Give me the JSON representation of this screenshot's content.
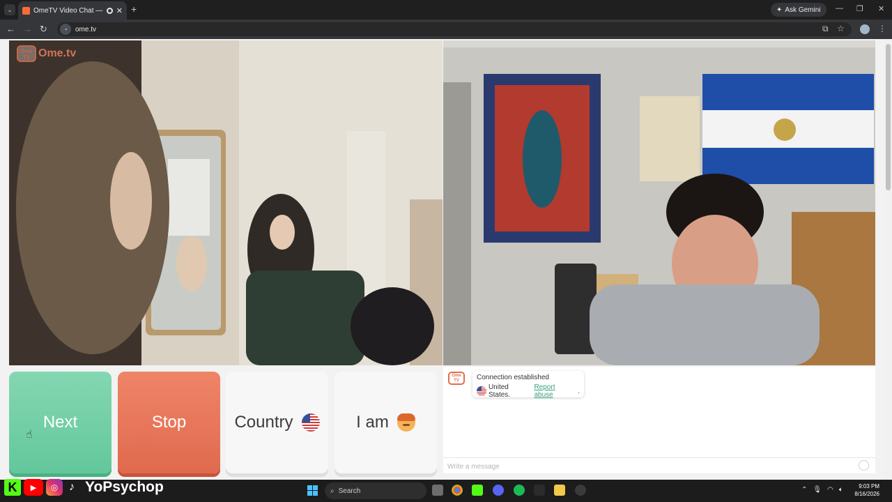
{
  "browser": {
    "tab_title": "OmeTV Video Chat — Ome",
    "tab_close": "✕",
    "new_tab": "+",
    "ask_gemini": "Ask Gemini",
    "url": "ome.tv",
    "window_controls": {
      "minimize": "—",
      "restore": "❐",
      "close": "✕"
    }
  },
  "logo": {
    "box_text": "Ome TV",
    "text": "Ome.tv"
  },
  "buttons": {
    "next": "Next",
    "stop": "Stop",
    "country": "Country",
    "i_am": "I am"
  },
  "chat": {
    "logo_text": "Ome TV",
    "message_line1": "Connection established",
    "message_country": "United States.",
    "report_link": "Report abuse",
    "message_end": ".",
    "input_placeholder": "Write a message"
  },
  "overlay": {
    "channel_name": "YoPsychop",
    "k_label": "K"
  },
  "taskbar": {
    "search_placeholder": "Search",
    "time": "9:03 PM",
    "date": "8/16/2026"
  },
  "icons": {
    "tab_list": "chevron-down-icon",
    "back": "arrow-left-icon",
    "forward": "arrow-right-icon",
    "reload": "reload-icon",
    "install": "install-app-icon",
    "bookmark": "star-icon",
    "menu": "kebab-menu-icon",
    "flag": "us-flag-icon",
    "emoji": "boy-emoji-icon"
  },
  "colors": {
    "next": "#63c79b",
    "stop": "#e06a4e",
    "accent": "#e56d4a",
    "link": "#3a9e78"
  }
}
